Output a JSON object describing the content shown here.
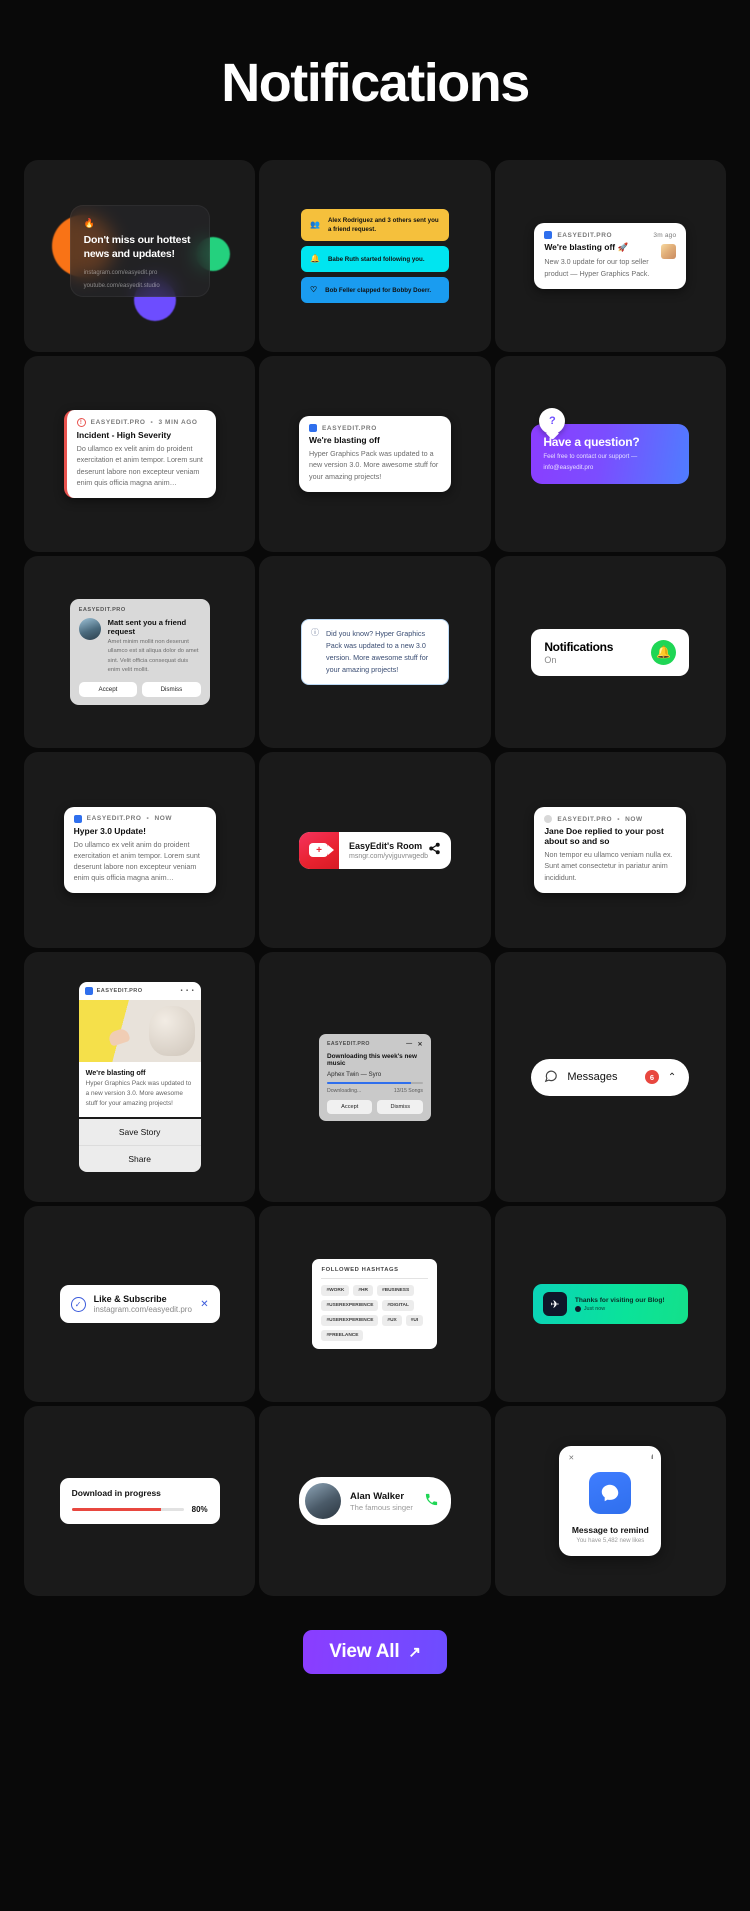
{
  "page": {
    "title": "Notifications"
  },
  "footer": {
    "view_all_label": "View All",
    "external_icon": "↗"
  },
  "cards": {
    "hero": {
      "flame_icon": "🔥",
      "headline": "Don't miss our hottest news and updates!",
      "link1": "instagram.com/easyedit.pro",
      "link2": "youtube.com/easyedit.studio"
    },
    "pills": [
      {
        "icon": "👥",
        "text": "Alex Rodriguez and 3 others sent you a friend request.",
        "color": "#f5c03c"
      },
      {
        "icon": "🔔",
        "text": "Babe Ruth started following you.",
        "color": "#00e5f0"
      },
      {
        "icon": "♡",
        "text": "Bob Feller clapped for Bobby Doerr.",
        "color": "#1a9cf0"
      }
    ],
    "blasting_toast": {
      "app": "EASYEDIT.PRO",
      "time": "3m ago",
      "title": "We're blasting off 🚀",
      "body": "New 3.0 update for our top seller product — Hyper Graphics Pack."
    },
    "incident": {
      "app": "EASYEDIT.PRO",
      "sep": "•",
      "time": "3 MIN AGO",
      "title": "Incident - High Severity",
      "body": "Do ullamco ex velit anim do proident exercitation et anim tempor. Lorem sunt deserunt labore non excepteur veniam enim quis officia magna anim…",
      "icon": "!"
    },
    "blasting_plain": {
      "app": "EASYEDIT.PRO",
      "title": "We're blasting off",
      "body": "Hyper Graphics Pack was updated to a new version 3.0. More awesome stuff for your amazing projects!"
    },
    "question": {
      "bubble_icon": "?",
      "title": "Have a question?",
      "body": "Feel free to contact our support — info@easyedit.pro"
    },
    "friend_request": {
      "app": "EASYEDIT.PRO",
      "title": "Matt sent you a friend request",
      "body": "Amet minim mollit non deserunt ullamco est sit aliqua dolor do amet sint. Velit officia consequat duis enim velit mollit.",
      "accept_label": "Accept",
      "dismiss_label": "Dismiss"
    },
    "did_you_know": {
      "icon": "ⓘ",
      "text": "Did you know? Hyper Graphics Pack was updated to a new 3.0 version. More awesome stuff for your amazing projects!"
    },
    "notifications_on": {
      "title": "Notifications",
      "status": "On",
      "bell_icon": "🔔"
    },
    "hyper_update": {
      "app": "EASYEDIT.PRO",
      "sep": "•",
      "time": "NOW",
      "title": "Hyper 3.0 Update!",
      "body": "Do ullamco ex velit anim do proident exercitation et anim tempor. Lorem sunt deserunt labore non excepteur veniam enim quis officia magna anim…"
    },
    "room": {
      "title": "EasyEdit's Room",
      "url": "msngr.com/yvjguvrwgedb",
      "share_icon": "⤳",
      "camera_icon": "+"
    },
    "jane_doe": {
      "app": "EASYEDIT.PRO",
      "sep": "•",
      "time": "NOW",
      "title": "Jane Doe replied to your post about so and so",
      "body": "Non tempor eu ullamco veniam nulla ex. Sunt amet consectetur in pariatur anim incididunt."
    },
    "story": {
      "app": "EASYEDIT.PRO",
      "more_icon": "• • •",
      "title": "We're blasting off",
      "body": "Hyper Graphics Pack was updated to a new version 3.0. More awesome stuff for your amazing projects!",
      "save_label": "Save Story",
      "share_label": "Share"
    },
    "download": {
      "app": "EASYEDIT.PRO",
      "minimize_icon": "—",
      "close_icon": "✕",
      "title": "Downloading this week's new music",
      "song": "Aphex Twin — Syro",
      "status": "Downloading...",
      "count": "13/15 Songs",
      "progress": 87,
      "accept_label": "Accept",
      "dismiss_label": "Dismiss"
    },
    "messages": {
      "chat_icon": "💬",
      "label": "Messages",
      "count": "6",
      "chevron_icon": "⌃"
    },
    "like_subscribe": {
      "check_icon": "✓",
      "title": "Like & Subscribe",
      "url": "instagram.com/easyedit.pro",
      "close_icon": "✕"
    },
    "hashtags": {
      "header": "FOLLOWED HASHTAGS",
      "tags": [
        "#WORK",
        "#HR",
        "#BUSINESS",
        "#USEREXPERIENCE",
        "#DIGITAL",
        "#USEREXPERIENCE",
        "#UX",
        "#UI",
        "#FREELANCE"
      ]
    },
    "thanks": {
      "telegram_icon": "✈",
      "title": "Thanks for visiting our Blog!",
      "sub": "Just now"
    },
    "progress": {
      "title": "Download in progress",
      "percent": "80%",
      "value": 80
    },
    "caller": {
      "name": "Alan Walker",
      "subtitle": "The famous singer",
      "call_icon": "📞"
    },
    "remind": {
      "close_icon": "✕",
      "signal_icon": "ıll",
      "message_icon": "💬",
      "title": "Message to remind",
      "sub": "You have 5,482 new likes"
    }
  }
}
